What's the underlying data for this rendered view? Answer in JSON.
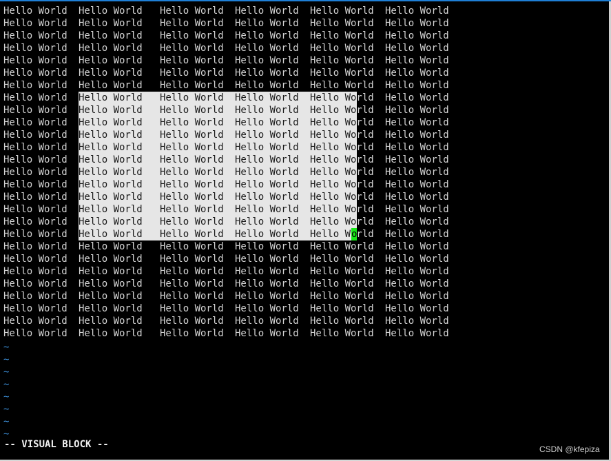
{
  "editor": {
    "columns": [
      "Hello World",
      "Hello World",
      "Hello World",
      "Hello World",
      "Hello World",
      "Hello World"
    ],
    "lines": [
      [
        "Hello World",
        "Hello World",
        "Hello World",
        "Hello World",
        "Hello World",
        "Hello World"
      ],
      [
        "Hello World",
        "Hello World",
        "Hello World",
        "Hello World",
        "Hello World",
        "Hello World"
      ],
      [
        "Hello World",
        "Hello World",
        "Hello World",
        "Hello World",
        "Hello World",
        "Hello World"
      ],
      [
        "Hello World",
        "Hello World",
        "Hello World",
        "Hello World",
        "Hello World",
        "Hello World"
      ],
      [
        "Hello World",
        "Hello World",
        "Hello World",
        "Hello World",
        "Hello World",
        "Hello World"
      ],
      [
        "Hello World",
        "Hello World",
        "Hello World",
        "Hello World",
        "Hello World",
        "Hello World"
      ],
      [
        "Hello World",
        "Hello World",
        "Hello World",
        "Hello World",
        "Hello World",
        "Hello World"
      ],
      [
        "Hello World",
        "Hello World",
        "Hello World",
        "Hello World",
        "Hello World",
        "Hello World"
      ],
      [
        "Hello World",
        "Hello World",
        "Hello World",
        "Hello World",
        "Hello World",
        "Hello World"
      ],
      [
        "Hello World",
        "Hello World",
        "Hello World",
        "Hello World",
        "Hello World",
        "Hello World"
      ],
      [
        "Hello World",
        "Hello World",
        "Hello World",
        "Hello World",
        "Hello World",
        "Hello World"
      ],
      [
        "Hello World",
        "Hello World",
        "Hello World",
        "Hello World",
        "Hello World",
        "Hello World"
      ],
      [
        "Hello World",
        "Hello World",
        "Hello World",
        "Hello World",
        "Hello World",
        "Hello World"
      ],
      [
        "Hello World",
        "Hello World",
        "Hello World",
        "Hello World",
        "Hello World",
        "Hello World"
      ],
      [
        "Hello World",
        "Hello World",
        "Hello World",
        "Hello World",
        "Hello World",
        "Hello World"
      ],
      [
        "Hello World",
        "Hello World",
        "Hello World",
        "Hello World",
        "Hello World",
        "Hello World"
      ],
      [
        "Hello World",
        "Hello World",
        "Hello World",
        "Hello World",
        "Hello World",
        "Hello World"
      ],
      [
        "Hello World",
        "Hello World",
        "Hello World",
        "Hello World",
        "Hello World",
        "Hello World"
      ],
      [
        "Hello World",
        "Hello World",
        "Hello World",
        "Hello World",
        "Hello World",
        "Hello World"
      ],
      [
        "Hello World",
        "Hello World",
        "Hello World",
        "Hello World",
        "Hello World",
        "Hello World"
      ],
      [
        "Hello World",
        "Hello World",
        "Hello World",
        "Hello World",
        "Hello World",
        "Hello World"
      ],
      [
        "Hello World",
        "Hello World",
        "Hello World",
        "Hello World",
        "Hello World",
        "Hello World"
      ],
      [
        "Hello World",
        "Hello World",
        "Hello World",
        "Hello World",
        "Hello World",
        "Hello World"
      ],
      [
        "Hello World",
        "Hello World",
        "Hello World",
        "Hello World",
        "Hello World",
        "Hello World"
      ],
      [
        "Hello World",
        "Hello World",
        "Hello World",
        "Hello World",
        "Hello World",
        "Hello World"
      ],
      [
        "Hello World",
        "Hello World",
        "Hello World",
        "Hello World",
        "Hello World",
        "Hello World"
      ],
      [
        "Hello World",
        "Hello World",
        "Hello World",
        "Hello World",
        "Hello World",
        "Hello World"
      ]
    ],
    "selection": {
      "first_line": 8,
      "last_line": 19,
      "mode": "block"
    },
    "cursor": {
      "line": 19,
      "char": "o"
    },
    "empty_line_marker": "~",
    "empty_line_count": 8
  },
  "status": {
    "mode": "-- VISUAL BLOCK --"
  },
  "watermark": "CSDN @kfepiza",
  "colors": {
    "background": "#000000",
    "text": "#d4d4d4",
    "selection": "#e6e6e6",
    "cursor": "#19e619",
    "tilde": "#3c8fd8",
    "border": "#1e7fd6"
  }
}
